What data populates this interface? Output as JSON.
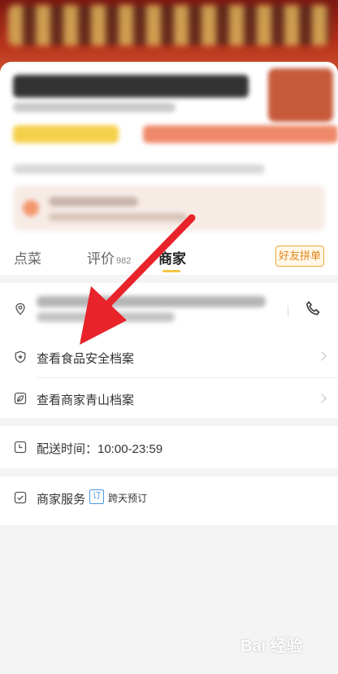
{
  "tabs": {
    "order": "点菜",
    "reviews": "评价",
    "reviews_count": "982",
    "merchant": "商家",
    "group_order": "好友拼单"
  },
  "merchant_info": {
    "food_safety": "查看食品安全档案",
    "green_archive": "查看商家青山档案",
    "delivery_time": "配送时间：10:00-23:59",
    "services_label": "商家服务",
    "service_tag_icon": "订",
    "service_tag_text": "跨天预订"
  },
  "watermark": {
    "text": "Bai 经验"
  },
  "icons": {
    "location": "location-pin-icon",
    "phone": "phone-icon",
    "food_safety": "shield-icon",
    "green": "leaf-icon",
    "time": "clock-icon",
    "service": "check-icon"
  },
  "colors": {
    "accent_yellow": "#f6c445",
    "group_btn": "#e3861c",
    "arrow_red": "#e8232a",
    "tag_blue": "#4b9ae8"
  }
}
